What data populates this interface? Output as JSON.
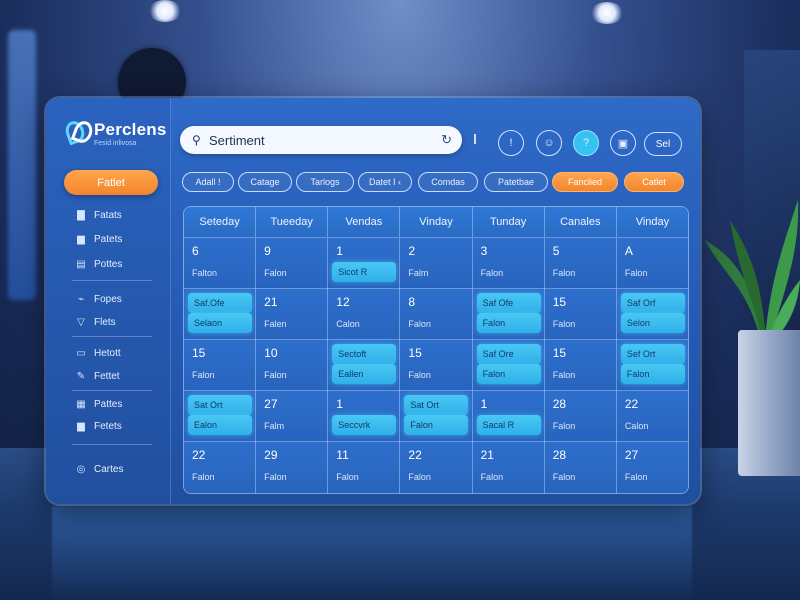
{
  "app": {
    "brand_name": "Perclens",
    "brand_sub": "Fesid inlivosa"
  },
  "sidebar": {
    "cta_label": "Fatlet",
    "items": [
      {
        "label": "Fatats",
        "icon": "folder-icon"
      },
      {
        "label": "Patets",
        "icon": "folder-icon"
      },
      {
        "label": "Pottes",
        "icon": "file-icon"
      },
      {
        "label": "Fopes",
        "icon": "link-icon"
      },
      {
        "label": "Flets",
        "icon": "shield-icon"
      },
      {
        "label": "Hetott",
        "icon": "document-icon"
      },
      {
        "label": "Fettet",
        "icon": "pen-icon"
      },
      {
        "label": "Pattes",
        "icon": "grid-icon"
      },
      {
        "label": "Fetets",
        "icon": "folder-icon"
      },
      {
        "label": "Cartes",
        "icon": "chat-icon"
      }
    ]
  },
  "header": {
    "search_value": "Sertiment",
    "buttons": [
      "!",
      "☺",
      "?",
      "▣"
    ],
    "right_pill": "Sel"
  },
  "filters": [
    {
      "label": "Adall !",
      "style": "outline"
    },
    {
      "label": "Catage",
      "style": "outline"
    },
    {
      "label": "Tarlogs",
      "style": "outline"
    },
    {
      "label": "Datet I ‹",
      "style": "outline"
    },
    {
      "label": "Comdas",
      "style": "outline"
    },
    {
      "label": "Patetbae",
      "style": "outline"
    },
    {
      "label": "Fanclied",
      "style": "orange"
    },
    {
      "label": "Catlet",
      "style": "orange"
    }
  ],
  "calendar": {
    "days": [
      "Seteday",
      "Tueeday",
      "Vendas",
      "Vinday",
      "Tunday",
      "Canales",
      "Vinday"
    ],
    "rows": [
      [
        {
          "num": "6",
          "label": "Falton"
        },
        {
          "num": "9",
          "label": "Falon"
        },
        {
          "num": "1",
          "events": [
            {
              "text": "Sicot R",
              "pos": "bottom"
            }
          ]
        },
        {
          "num": "2",
          "label": "Falm"
        },
        {
          "num": "3",
          "label": "Falon"
        },
        {
          "num": "5",
          "label": "Falon"
        },
        {
          "num": "A",
          "label": "Falon"
        }
      ],
      [
        {
          "num": "",
          "events": [
            {
              "text": "Saf.Ofe",
              "pos": "top"
            },
            {
              "text": "Selaon",
              "pos": "bottom"
            }
          ]
        },
        {
          "num": "21",
          "label": "Falen"
        },
        {
          "num": "12",
          "label": "Calon"
        },
        {
          "num": "8",
          "label": "Falon"
        },
        {
          "num": "",
          "events": [
            {
              "text": "Saf Ofe",
              "pos": "top"
            },
            {
              "text": "Falon",
              "pos": "bottom"
            }
          ]
        },
        {
          "num": "15",
          "label": "Falon"
        },
        {
          "num": "",
          "events": [
            {
              "text": "Saf Orf",
              "pos": "top"
            },
            {
              "text": "Selon",
              "pos": "bottom"
            }
          ]
        }
      ],
      [
        {
          "num": "15",
          "label": "Falon"
        },
        {
          "num": "10",
          "label": "Falon"
        },
        {
          "num": "",
          "events": [
            {
              "text": "Sectoft",
              "pos": "top"
            },
            {
              "text": "Eallen",
              "pos": "bottom"
            }
          ]
        },
        {
          "num": "15",
          "label": "Falon"
        },
        {
          "num": "",
          "events": [
            {
              "text": "Saf Ore",
              "pos": "top"
            },
            {
              "text": "Falon",
              "pos": "bottom"
            }
          ]
        },
        {
          "num": "15",
          "label": "Falon"
        },
        {
          "num": "",
          "events": [
            {
              "text": "Sef Ort",
              "pos": "top"
            },
            {
              "text": "Falon",
              "pos": "bottom"
            }
          ]
        }
      ],
      [
        {
          "num": "",
          "events": [
            {
              "text": "Sat Ort",
              "pos": "top"
            },
            {
              "text": "Ealon",
              "pos": "bottom"
            }
          ]
        },
        {
          "num": "27",
          "label": "Falm"
        },
        {
          "num": "1",
          "events": [
            {
              "text": "Seccvrk",
              "pos": "bottom"
            }
          ]
        },
        {
          "num": "",
          "events": [
            {
              "text": "Sat Ort",
              "pos": "top"
            },
            {
              "text": "Falon",
              "pos": "bottom"
            }
          ]
        },
        {
          "num": "1",
          "events": [
            {
              "text": "Sacal R",
              "pos": "bottom"
            }
          ]
        },
        {
          "num": "28",
          "label": "Falon"
        },
        {
          "num": "22",
          "label": "Calon"
        }
      ],
      [
        {
          "num": "22",
          "label": "Falon"
        },
        {
          "num": "29",
          "label": "Falon"
        },
        {
          "num": "11",
          "label": "Falon"
        },
        {
          "num": "22",
          "label": "Falon"
        },
        {
          "num": "21",
          "label": "Falon"
        },
        {
          "num": "28",
          "label": "Falon"
        },
        {
          "num": "27",
          "label": "Falon"
        }
      ]
    ]
  },
  "colors": {
    "accent": "#36c3f2",
    "orange": "#f2852d",
    "panel": "#2459b3"
  }
}
